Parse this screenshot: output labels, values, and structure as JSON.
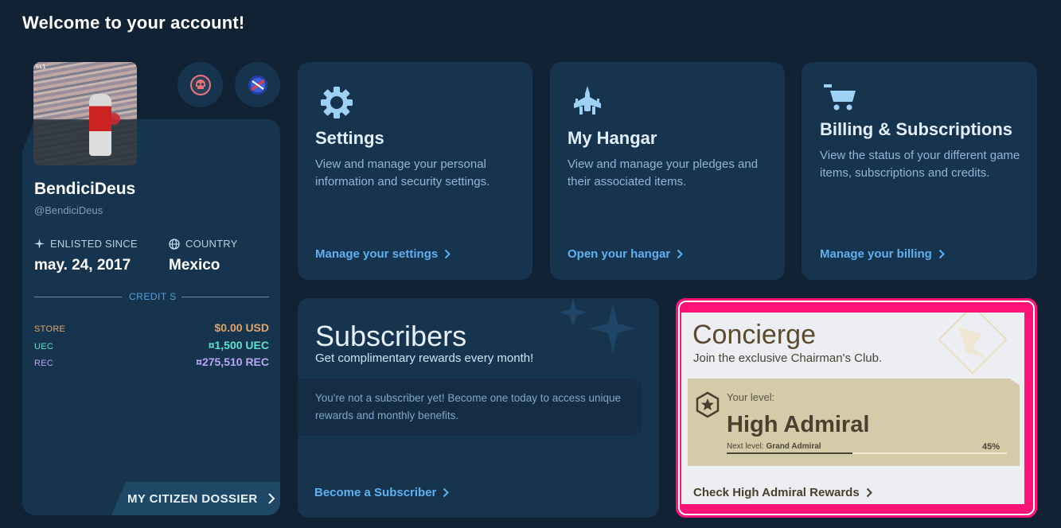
{
  "page": {
    "title": "Welcome to your account!"
  },
  "profile": {
    "avatar_label": "SL1",
    "username": "BendiciDeus",
    "handle": "@BendiciDeus",
    "enlisted_label": "ENLISTED SINCE",
    "enlisted_value": "may. 24, 2017",
    "country_label": "COUNTRY",
    "country_value": "Mexico",
    "credits_title": "CREDIT S",
    "credits": [
      {
        "key": "STORE",
        "value": "$0.00 USD",
        "color": "#e0a56a"
      },
      {
        "key": "UEC",
        "value": "¤1,500 UEC",
        "color": "#5fe0c9"
      },
      {
        "key": "REC",
        "value": "¤275,510 REC",
        "color": "#b7a7f0"
      }
    ],
    "dossier_label": "MY CITIZEN DOSSIER"
  },
  "cards": {
    "settings": {
      "title": "Settings",
      "desc": "View and manage your personal information and security settings.",
      "link": "Manage your settings"
    },
    "hangar": {
      "title": "My Hangar",
      "desc": "View and manage your pledges and their associated items.",
      "link": "Open your hangar"
    },
    "billing": {
      "title": "Billing & Subscriptions",
      "desc": "View the status of your different game items, subscriptions and credits.",
      "link": "Manage your billing"
    }
  },
  "subscribers": {
    "title": "Subscribers",
    "subtitle": "Get complimentary rewards every month!",
    "notice": "You're not a subscriber yet! Become one today to access unique rewards and monthly benefits.",
    "link": "Become a Subscriber"
  },
  "concierge": {
    "title": "Concierge",
    "subtitle": "Join the exclusive Chairman's Club.",
    "level_label": "Your level:",
    "level_value": "High Admiral",
    "next_level_prefix": "Next level:",
    "next_level_value": "Grand Admiral",
    "progress_label": "45%",
    "progress_fraction": 0.45,
    "link": "Check High Admiral Rewards"
  },
  "colors": {
    "background": "#102233",
    "card": "#17344f",
    "accent_link": "#5fb0ee",
    "highlight_border": "#ff1177",
    "concierge_gold": "#d4cba9"
  }
}
